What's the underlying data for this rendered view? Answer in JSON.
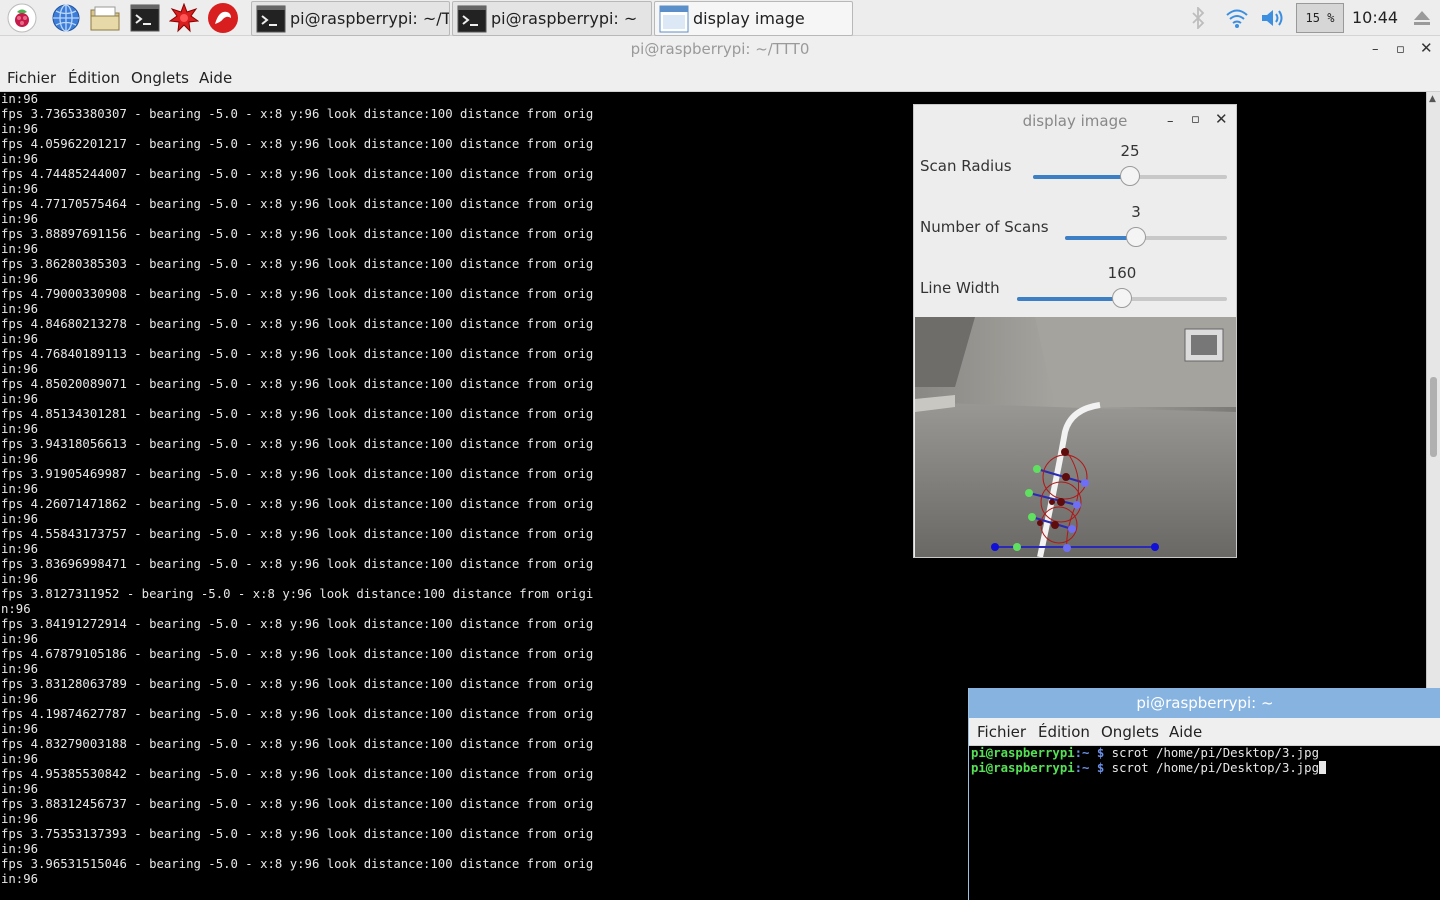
{
  "taskbar": {
    "launchers": [
      {
        "name": "raspberry-menu-icon"
      },
      {
        "name": "web-browser-icon"
      },
      {
        "name": "file-manager-icon"
      },
      {
        "name": "terminal-icon"
      },
      {
        "name": "mathematica-icon"
      },
      {
        "name": "wolfram-icon"
      }
    ],
    "tasks": [
      {
        "label": "pi@raspberrypi: ~/TT…",
        "icon": "terminal-icon"
      },
      {
        "label": "pi@raspberrypi: ~",
        "icon": "terminal-icon"
      },
      {
        "label": "display image",
        "icon": "window-icon"
      }
    ],
    "cpu": "15 %",
    "clock": "10:44"
  },
  "main_window": {
    "title": "pi@raspberrypi: ~/TTT0",
    "menu": [
      "Fichier",
      "Édition",
      "Onglets",
      "Aide"
    ],
    "lines": [
      "in:96",
      "fps 3.73653380307 - bearing -5.0 - x:8 y:96 look distance:100 distance from orig",
      "in:96",
      "fps 4.05962201217 - bearing -5.0 - x:8 y:96 look distance:100 distance from orig",
      "in:96",
      "fps 4.74485244007 - bearing -5.0 - x:8 y:96 look distance:100 distance from orig",
      "in:96",
      "fps 4.77170575464 - bearing -5.0 - x:8 y:96 look distance:100 distance from orig",
      "in:96",
      "fps 3.88897691156 - bearing -5.0 - x:8 y:96 look distance:100 distance from orig",
      "in:96",
      "fps 3.86280385303 - bearing -5.0 - x:8 y:96 look distance:100 distance from orig",
      "in:96",
      "fps 4.79000330908 - bearing -5.0 - x:8 y:96 look distance:100 distance from orig",
      "in:96",
      "fps 4.84680213278 - bearing -5.0 - x:8 y:96 look distance:100 distance from orig",
      "in:96",
      "fps 4.76840189113 - bearing -5.0 - x:8 y:96 look distance:100 distance from orig",
      "in:96",
      "fps 4.85020089071 - bearing -5.0 - x:8 y:96 look distance:100 distance from orig",
      "in:96",
      "fps 4.85134301281 - bearing -5.0 - x:8 y:96 look distance:100 distance from orig",
      "in:96",
      "fps 3.94318056613 - bearing -5.0 - x:8 y:96 look distance:100 distance from orig",
      "in:96",
      "fps 3.91905469987 - bearing -5.0 - x:8 y:96 look distance:100 distance from orig",
      "in:96",
      "fps 4.26071471862 - bearing -5.0 - x:8 y:96 look distance:100 distance from orig",
      "in:96",
      "fps 4.55843173757 - bearing -5.0 - x:8 y:96 look distance:100 distance from orig",
      "in:96",
      "fps 3.83696998471 - bearing -5.0 - x:8 y:96 look distance:100 distance from orig",
      "in:96",
      "fps 3.8127311952 - bearing -5.0 - x:8 y:96 look distance:100 distance from origi",
      "n:96",
      "fps 3.84191272914 - bearing -5.0 - x:8 y:96 look distance:100 distance from orig",
      "in:96",
      "fps 4.67879105186 - bearing -5.0 - x:8 y:96 look distance:100 distance from orig",
      "in:96",
      "fps 3.83128063789 - bearing -5.0 - x:8 y:96 look distance:100 distance from orig",
      "in:96",
      "fps 4.19874627787 - bearing -5.0 - x:8 y:96 look distance:100 distance from orig",
      "in:96",
      "fps 4.83279003188 - bearing -5.0 - x:8 y:96 look distance:100 distance from orig",
      "in:96",
      "fps 4.95385530842 - bearing -5.0 - x:8 y:96 look distance:100 distance from orig",
      "in:96",
      "fps 3.88312456737 - bearing -5.0 - x:8 y:96 look distance:100 distance from orig",
      "in:96",
      "fps 3.75353137393 - bearing -5.0 - x:8 y:96 look distance:100 distance from orig",
      "in:96",
      "fps 3.96531515046 - bearing -5.0 - x:8 y:96 look distance:100 distance from orig",
      "in:96"
    ]
  },
  "display_window": {
    "title": "display image",
    "sliders": [
      {
        "label": "Scan Radius",
        "value": "25",
        "fraction": 0.5
      },
      {
        "label": "Number of Scans",
        "value": "3",
        "fraction": 0.44
      },
      {
        "label": "Line Width",
        "value": "160",
        "fraction": 0.5
      }
    ]
  },
  "second_terminal": {
    "title": "pi@raspberrypi: ~",
    "menu": [
      "Fichier",
      "Édition",
      "Onglets",
      "Aide"
    ],
    "lines": [
      {
        "prompt": "pi@raspberrypi",
        "path": ":~ ",
        "dollar": "$",
        "cmd": " scrot /home/pi/Desktop/3.jpg"
      },
      {
        "prompt": "pi@raspberrypi",
        "path": ":~ ",
        "dollar": "$",
        "cmd": " scrot /home/pi/Desktop/3.jpg"
      }
    ]
  }
}
